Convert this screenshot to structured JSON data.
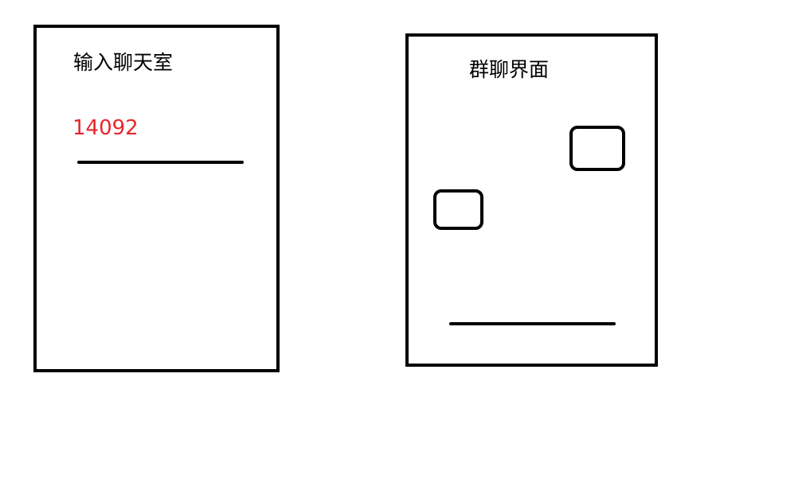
{
  "join_screen": {
    "title": "输入聊天室",
    "room_id": "14092",
    "room_id_color": "#e8262c"
  },
  "group_chat_screen": {
    "title": "群聊界面"
  }
}
